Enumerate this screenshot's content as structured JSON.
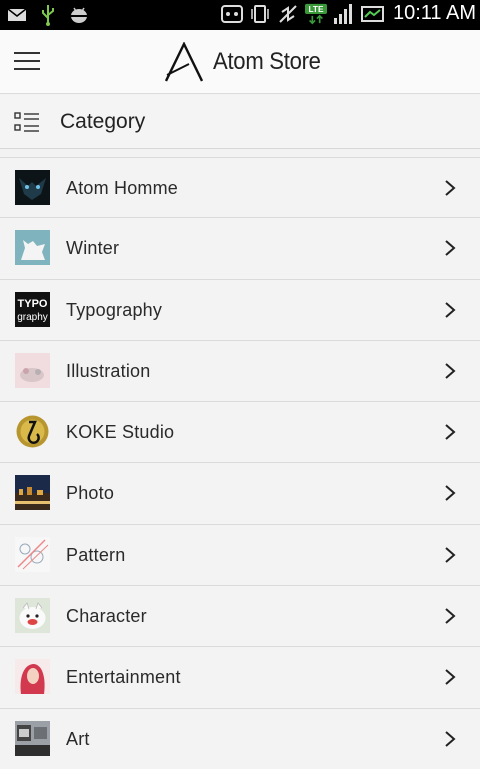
{
  "status_bar": {
    "time": "10:11 AM",
    "network": "LTE",
    "icons": [
      "mail-icon",
      "usb-icon",
      "android-debug-icon",
      "screen-icon",
      "vibrate-icon",
      "no-sync-icon",
      "lte-icon",
      "signal-icon",
      "battery-icon"
    ]
  },
  "app_bar": {
    "title": "Atom Store",
    "logo_letter": "A"
  },
  "category_header": {
    "label": "Category"
  },
  "categories": [
    {
      "label": "Atom Homme",
      "thumbnail": "dark-mask-thumbnail"
    },
    {
      "label": "Winter",
      "thumbnail": "fox-thumbnail"
    },
    {
      "label": "Typography",
      "thumbnail": "typography-thumbnail"
    },
    {
      "label": "Illustration",
      "thumbnail": "illustration-thumbnail"
    },
    {
      "label": "KOKE Studio",
      "thumbnail": "koke-logo-thumbnail"
    },
    {
      "label": "Photo",
      "thumbnail": "city-night-thumbnail"
    },
    {
      "label": "Pattern",
      "thumbnail": "pattern-thumbnail"
    },
    {
      "label": "Character",
      "thumbnail": "character-thumbnail"
    },
    {
      "label": "Entertainment",
      "thumbnail": "portrait-thumbnail"
    },
    {
      "label": "Art",
      "thumbnail": "street-art-thumbnail"
    }
  ],
  "thumbnail_text": {
    "typo_top": "TYPO",
    "typo_bottom": "graphy"
  }
}
